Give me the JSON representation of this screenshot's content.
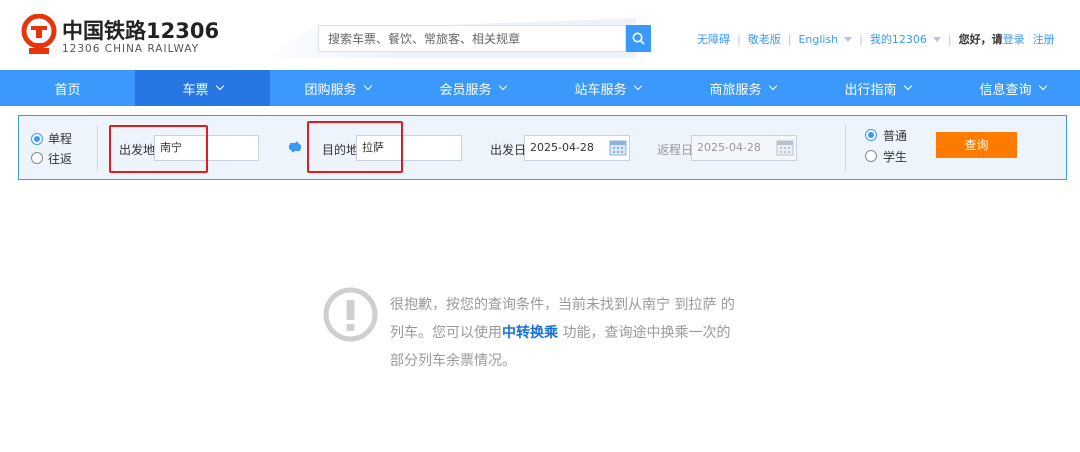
{
  "logo": {
    "name_cn": "中国铁路12306",
    "name_en": "12306 CHINA RAILWAY"
  },
  "search": {
    "placeholder": "搜索车票、餐饮、常旅客、相关规章"
  },
  "toplinks": {
    "accessibility": "无障碍",
    "elder": "敬老版",
    "english": "English",
    "my12306": "我的12306",
    "greeting": "您好，请",
    "login": "登录",
    "register": "注册"
  },
  "nav": {
    "items": [
      {
        "label": "首页",
        "has_menu": false,
        "active": false
      },
      {
        "label": "车票",
        "has_menu": true,
        "active": true
      },
      {
        "label": "团购服务",
        "has_menu": true,
        "active": false
      },
      {
        "label": "会员服务",
        "has_menu": true,
        "active": false
      },
      {
        "label": "站车服务",
        "has_menu": true,
        "active": false
      },
      {
        "label": "商旅服务",
        "has_menu": true,
        "active": false
      },
      {
        "label": "出行指南",
        "has_menu": true,
        "active": false
      },
      {
        "label": "信息查询",
        "has_menu": true,
        "active": false
      }
    ]
  },
  "query": {
    "trip_type": {
      "one_way": "单程",
      "round_trip": "往返",
      "selected": "one_way"
    },
    "from_label": "出发地",
    "from_value": "南宁",
    "to_label": "目的地",
    "to_value": "拉萨",
    "depart_label": "出发日",
    "depart_value": "2025-04-28",
    "return_label": "返程日",
    "return_value": "2025-04-28",
    "ticket_type": {
      "normal": "普通",
      "student": "学生",
      "selected": "normal"
    },
    "submit_label": "查询"
  },
  "result": {
    "line1": "很抱歉，按您的查询条件，当前未找到从南宁 到拉萨 的",
    "line2_pre": "列车。您可以使用",
    "link": "中转换乘",
    "line2_post": " 功能，查询途中换乘一次的",
    "line3": "部分列车余票情况。"
  },
  "colors": {
    "brand_blue": "#3b99fc",
    "nav_active": "#2676e3",
    "query_orange": "#ff7a00",
    "logo_red": "#e8340a",
    "highlight_red": "#e21b1b"
  },
  "icons": [
    "railway-logo-icon",
    "search-icon",
    "swap-icon",
    "calendar-icon",
    "warning-icon",
    "chevron-down-icon"
  ]
}
